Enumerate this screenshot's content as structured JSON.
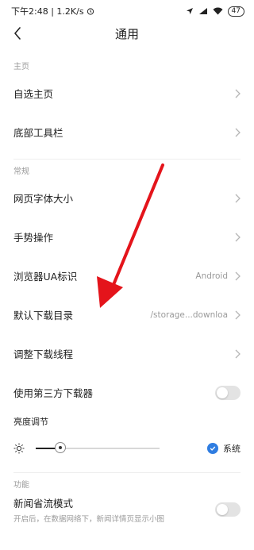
{
  "status": {
    "time_speed": "下午2:48 | 1.2K/s",
    "battery": "47"
  },
  "header": {
    "title": "通用"
  },
  "sections": {
    "home": {
      "label": "主页",
      "items": [
        {
          "label": "自选主页"
        },
        {
          "label": "底部工具栏"
        }
      ]
    },
    "general": {
      "label": "常规",
      "items": [
        {
          "label": "网页字体大小"
        },
        {
          "label": "手势操作"
        },
        {
          "label": "浏览器UA标识",
          "value": "Android"
        },
        {
          "label": "默认下载目录",
          "value": "/storage...downloa"
        },
        {
          "label": "调整下载线程"
        },
        {
          "label": "使用第三方下载器",
          "toggle": false
        }
      ]
    },
    "brightness": {
      "label": "亮度调节",
      "level": 0.2,
      "system_label": "系统",
      "system_checked": true
    },
    "features": {
      "label": "功能",
      "items": [
        {
          "label": "新闻省流模式",
          "sub": "开启后，在数据网络下，新闻详情页显示小图",
          "toggle": false
        }
      ]
    }
  },
  "colors": {
    "accent": "#2f7de1",
    "arrow": "#e4141b"
  }
}
